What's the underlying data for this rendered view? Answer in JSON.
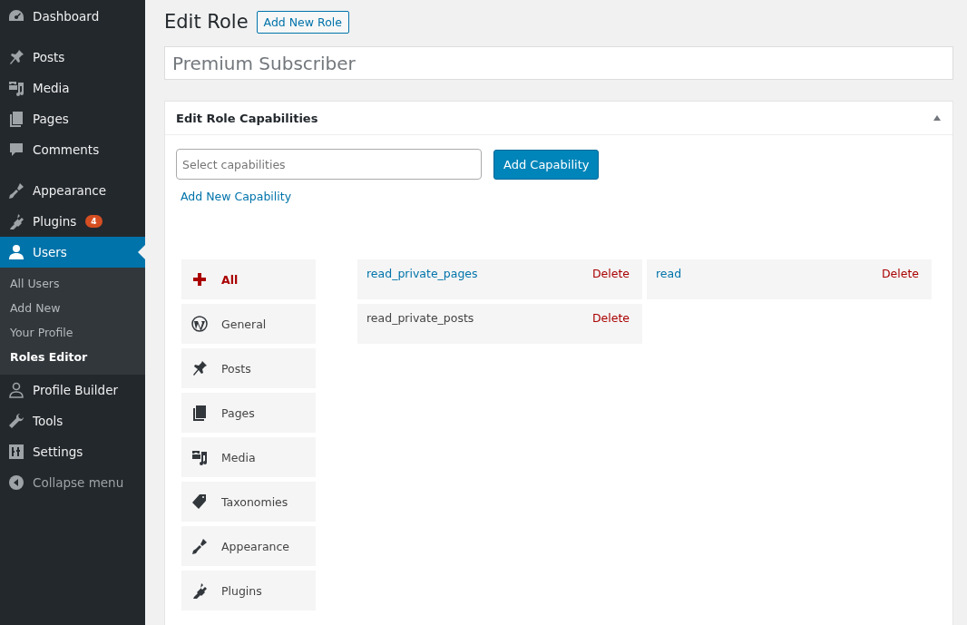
{
  "sidebar": {
    "groups": [
      {
        "items": [
          {
            "label": "Dashboard",
            "selected": false
          }
        ]
      },
      {
        "items": [
          {
            "label": "Posts",
            "selected": false
          },
          {
            "label": "Media",
            "selected": false
          },
          {
            "label": "Pages",
            "selected": false
          },
          {
            "label": "Comments",
            "selected": false
          }
        ]
      },
      {
        "items": [
          {
            "label": "Appearance",
            "selected": false
          },
          {
            "label": "Plugins",
            "selected": false,
            "badge": "4"
          },
          {
            "label": "Users",
            "selected": true,
            "submenu": [
              {
                "label": "All Users",
                "selected": false
              },
              {
                "label": "Add New",
                "selected": false
              },
              {
                "label": "Your Profile",
                "selected": false
              },
              {
                "label": "Roles Editor",
                "selected": true
              }
            ]
          },
          {
            "label": "Profile Builder",
            "selected": false
          },
          {
            "label": "Tools",
            "selected": false
          },
          {
            "label": "Settings",
            "selected": false
          },
          {
            "label": "Collapse menu",
            "selected": false,
            "kind": "collapse"
          }
        ]
      }
    ]
  },
  "page": {
    "title": "Edit Role",
    "add_button": "Add New Role",
    "role_name": "Premium Subscriber"
  },
  "postbox": {
    "title": "Edit Role Capabilities",
    "expanded": true,
    "capability_field": {
      "placeholder": "Select capabilities"
    },
    "add_capability_button": "Add Capability",
    "add_new_link": "Add New Capability",
    "categories": [
      {
        "label": "All",
        "selected": true
      },
      {
        "label": "General",
        "selected": false
      },
      {
        "label": "Posts",
        "selected": false
      },
      {
        "label": "Pages",
        "selected": false
      },
      {
        "label": "Media",
        "selected": false
      },
      {
        "label": "Taxonomies",
        "selected": false
      },
      {
        "label": "Appearance",
        "selected": false
      },
      {
        "label": "Plugins",
        "selected": false
      }
    ],
    "capabilities": [
      {
        "name": "read_private_pages",
        "linked": true,
        "action": "Delete"
      },
      {
        "name": "read",
        "linked": true,
        "action": "Delete"
      },
      {
        "name": "read_private_posts",
        "linked": false,
        "action": "Delete"
      }
    ]
  }
}
